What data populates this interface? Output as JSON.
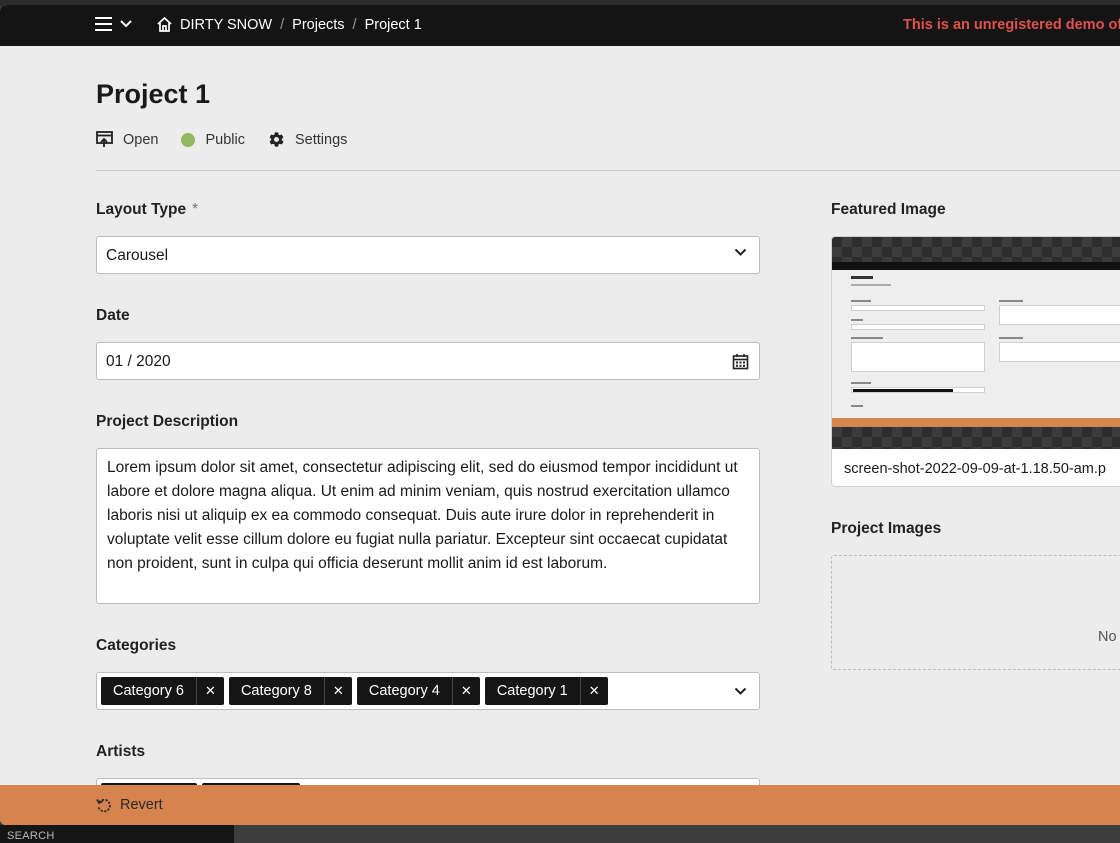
{
  "topbar": {
    "brand": "DIRTY SNOW",
    "crumb_projects": "Projects",
    "crumb_current": "Project 1",
    "demo_notice": "This is an unregistered demo of I"
  },
  "page": {
    "title": "Project 1",
    "actions": {
      "open": "Open",
      "visibility": "Public",
      "settings": "Settings"
    }
  },
  "form": {
    "layout_type": {
      "label": "Layout Type",
      "required_mark": "*",
      "value": "Carousel"
    },
    "date": {
      "label": "Date",
      "value": "01 / 2020"
    },
    "description": {
      "label": "Project Description",
      "value": "Lorem ipsum dolor sit amet, consectetur adipiscing elit, sed do eiusmod tempor incididunt ut labore et dolore magna aliqua. Ut enim ad minim veniam, quis nostrud exercitation ullamco laboris nisi ut aliquip ex ea commodo consequat. Duis aute irure dolor in reprehenderit in voluptate velit esse cillum dolore eu fugiat nulla pariatur. Excepteur sint occaecat cupidatat non proident, sunt in culpa qui officia deserunt mollit anim id est laborum."
    },
    "categories": {
      "label": "Categories",
      "tags": [
        "Category 6",
        "Category 8",
        "Category 4",
        "Category 1"
      ]
    },
    "artists": {
      "label": "Artists"
    }
  },
  "side": {
    "featured_label": "Featured Image",
    "featured_filename": "screen-shot-2022-09-09-at-1.18.50-am.p",
    "images_label": "Project Images",
    "images_empty": "No"
  },
  "footer": {
    "revert": "Revert"
  },
  "dock": {
    "search": "SEARCH"
  },
  "colors": {
    "accent": "#d6844f",
    "public_dot": "#93b95e",
    "demo_text": "#e0524d"
  }
}
